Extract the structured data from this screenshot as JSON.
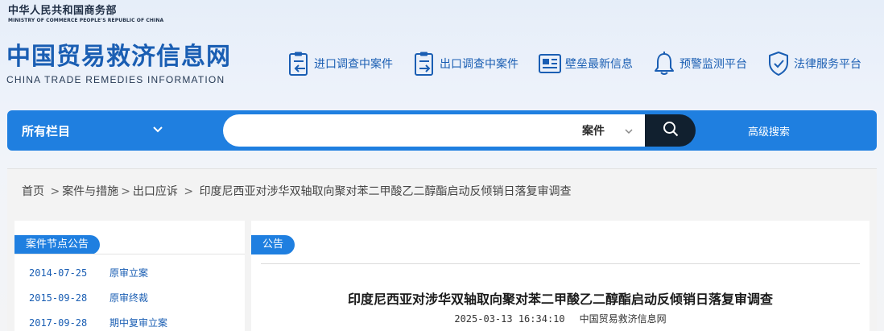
{
  "header": {
    "ministry_cn": "中华人民共和国商务部",
    "ministry_en": "MINISTRY OF COMMERCE PEOPLE'S REPUBLIC OF CHINA",
    "site_cn": "中国贸易救济信息网",
    "site_en": "CHINA TRADE REMEDIES INFORMATION"
  },
  "nav": [
    {
      "label": "进口调查中案件",
      "icon": "import-case-icon"
    },
    {
      "label": "出口调查中案件",
      "icon": "export-case-icon"
    },
    {
      "label": "壁垒最新信息",
      "icon": "news-icon"
    },
    {
      "label": "预警监测平台",
      "icon": "bell-icon"
    },
    {
      "label": "法律服务平台",
      "icon": "shield-icon"
    }
  ],
  "search": {
    "column_label": "所有栏目",
    "input_value": "",
    "type_label": "案件",
    "advanced_label": "高级搜索"
  },
  "breadcrumb": [
    "首页",
    "案件与措施",
    "出口应诉",
    "印度尼西亚对涉华双轴取向聚对苯二甲酸乙二醇酯启动反倾销日落复审调查"
  ],
  "left_panel": {
    "title": "案件节点公告",
    "events": [
      {
        "date": "2014-07-25",
        "label": "原审立案"
      },
      {
        "date": "2015-09-28",
        "label": "原审终裁"
      },
      {
        "date": "2017-09-28",
        "label": "期中复审立案"
      }
    ]
  },
  "article": {
    "tab_label": "公告",
    "title": "印度尼西亚对涉华双轴取向聚对苯二甲酸乙二醇酯启动反倾销日落复审调查",
    "datetime": "2025-03-13 16:34:10",
    "source": "中国贸易救济信息网"
  },
  "colors": {
    "primary": "#1f7fe0",
    "dark": "#11202f",
    "link": "#1a5eb3"
  }
}
